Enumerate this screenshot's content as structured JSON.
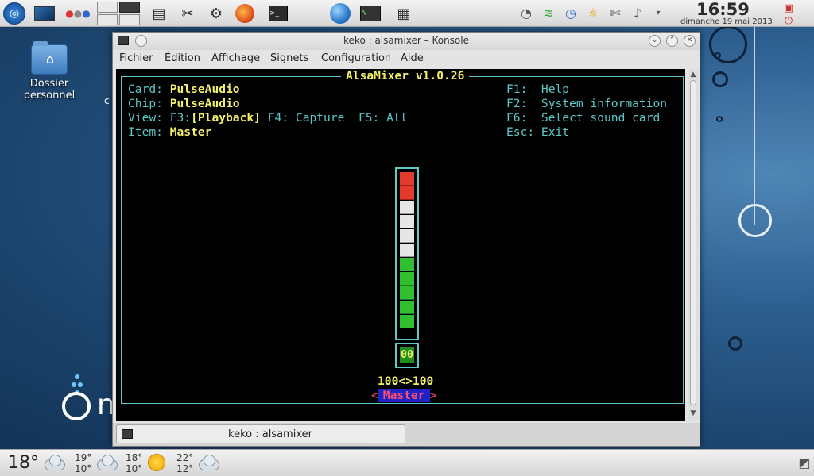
{
  "top_panel": {
    "clock_time": "16:59",
    "clock_date": "dimanche 19 mai 2013"
  },
  "desktop": {
    "icon_label_1": "Dossier",
    "icon_label_2": "personnel",
    "partial_text": "c"
  },
  "window": {
    "title": "keko : alsamixer – Konsole",
    "menu": [
      "Fichier",
      "Édition",
      "Affichage",
      "Signets",
      "Configuration",
      "Aide"
    ],
    "tab_label": "keko : alsamixer"
  },
  "alsamixer": {
    "title": "AlsaMixer v1.0.26",
    "card_label": "Card:",
    "card_value": "PulseAudio",
    "chip_label": "Chip:",
    "chip_value": "PulseAudio",
    "view_label": "View:",
    "view_f3": "F3:",
    "view_playback": "[Playback]",
    "view_rest": "F4: Capture  F5: All",
    "item_label": "Item:",
    "item_value": "Master",
    "help": [
      "F1:  Help",
      "F2:  System information",
      "F6:  Select sound card",
      "Esc: Exit"
    ],
    "mute_label": "00",
    "volume_text": "100<>100",
    "control_name": "Master",
    "volume_percent": 100
  },
  "weather": {
    "current": "18°",
    "days": [
      {
        "high": "19°",
        "low": "10°",
        "icon": "cloud-icon"
      },
      {
        "high": "18°",
        "low": "10°",
        "icon": "sun-icon"
      },
      {
        "high": "22°",
        "low": "12°",
        "icon": "cloud-icon"
      }
    ]
  },
  "colors": {
    "terminal_bg": "#000000",
    "terminal_cyan": "#5ec8c8",
    "terminal_yellow": "#f3f06a",
    "vol_red": "#e23b2e",
    "vol_white": "#e6e6e6",
    "vol_green": "#2fbf2f"
  }
}
